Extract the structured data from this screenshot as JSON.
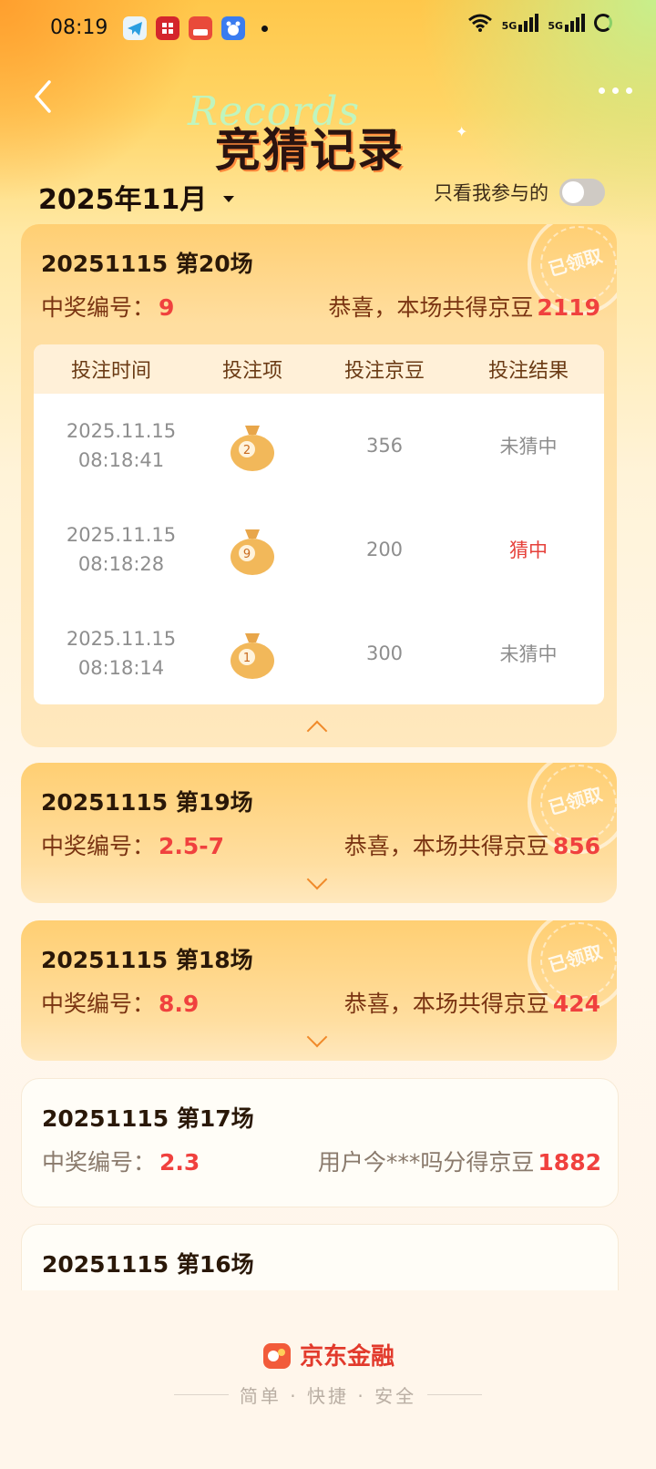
{
  "status_bar": {
    "time": "08:19",
    "signal1": "5G",
    "signal2": "5G"
  },
  "header": {
    "title": "竞猜记录",
    "title_bg": "Records"
  },
  "filter": {
    "month": "2025年11月",
    "only_mine_label": "只看我参与的",
    "only_mine_on": false
  },
  "rounds": [
    {
      "title": "20251115 第20场",
      "win_label": "中奖编号：",
      "win_number": "9",
      "prize_text": "恭喜，本场共得京豆",
      "prize_amount": "2119",
      "stamp": "已领取",
      "expanded": true,
      "table_headers": [
        "投注时间",
        "投注项",
        "投注京豆",
        "投注结果"
      ],
      "bets": [
        {
          "date": "2025.11.15",
          "time": "08:18:41",
          "item": "2",
          "beans": "356",
          "result": "未猜中"
        },
        {
          "date": "2025.11.15",
          "time": "08:18:28",
          "item": "9",
          "beans": "200",
          "result": "猜中"
        },
        {
          "date": "2025.11.15",
          "time": "08:18:14",
          "item": "1",
          "beans": "300",
          "result": "未猜中"
        }
      ]
    },
    {
      "title": "20251115 第19场",
      "win_label": "中奖编号：",
      "win_number": "2.5-7",
      "prize_text": "恭喜，本场共得京豆",
      "prize_amount": "856",
      "stamp": "已领取"
    },
    {
      "title": "20251115 第18场",
      "win_label": "中奖编号：",
      "win_number": "8.9",
      "prize_text": "恭喜，本场共得京豆",
      "prize_amount": "424",
      "stamp": "已领取"
    },
    {
      "title": "20251115 第17场",
      "win_label": "中奖编号：",
      "win_number": "2.3",
      "prize_text": "用户今***吗分得京豆",
      "prize_amount": "1882"
    },
    {
      "title": "20251115 第16场"
    }
  ],
  "footer": {
    "brand": "京东金融",
    "slogan": "简单 · 快捷 · 安全"
  },
  "colors": {
    "accent_red": "#f0413e",
    "card_orange": "#ffcf73"
  }
}
